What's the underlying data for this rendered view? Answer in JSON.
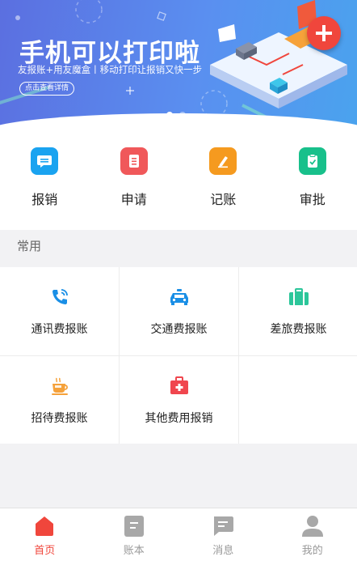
{
  "banner": {
    "headline": "手机可以打印啦",
    "subline": "友报账+用友魔盒丨移动打印让报销又快一步",
    "detail_button": "点击查看详情",
    "add_button_icon": "plus-icon",
    "page_indicator": {
      "current": 1,
      "total": 2
    }
  },
  "quick_actions": [
    {
      "label": "报销",
      "icon": "message-icon",
      "color": "#1aa3f0"
    },
    {
      "label": "申请",
      "icon": "document-icon",
      "color": "#f0585a"
    },
    {
      "label": "记账",
      "icon": "pen-icon",
      "color": "#f59a1f"
    },
    {
      "label": "审批",
      "icon": "clipboard-check-icon",
      "color": "#18c08b"
    }
  ],
  "common": {
    "title": "常用",
    "items": [
      {
        "label": "通讯费报账",
        "icon": "phone-icon",
        "color": "#1a8fe6"
      },
      {
        "label": "交通费报账",
        "icon": "taxi-icon",
        "color": "#1a8fe6"
      },
      {
        "label": "差旅费报账",
        "icon": "suitcase-icon",
        "color": "#2cc69a"
      },
      {
        "label": "招待费报账",
        "icon": "coffee-cup-icon",
        "color": "#f5a13a"
      },
      {
        "label": "其他费用报销",
        "icon": "medical-kit-icon",
        "color": "#f0464e"
      }
    ]
  },
  "tabbar": {
    "active_color": "#f0463c",
    "inactive_color": "#999999",
    "tabs": [
      {
        "label": "首页",
        "icon": "home-icon",
        "active": true
      },
      {
        "label": "账本",
        "icon": "ledger-icon",
        "active": false
      },
      {
        "label": "消息",
        "icon": "chat-icon",
        "active": false
      },
      {
        "label": "我的",
        "icon": "user-icon",
        "active": false
      }
    ]
  }
}
